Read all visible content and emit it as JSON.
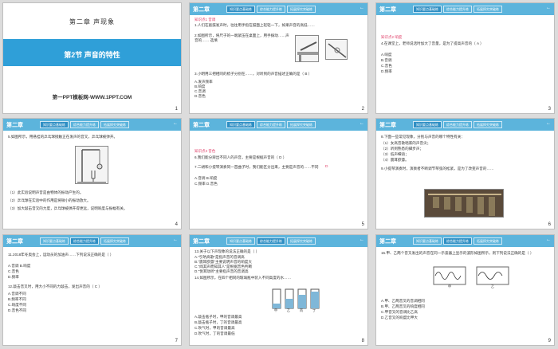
{
  "common": {
    "chapter": "第二章",
    "tabs": [
      "知识要点基础练",
      "综合能力提升练",
      "拓展探究突破练"
    ],
    "back": "←"
  },
  "slides": [
    {
      "num": "1",
      "chapter_title": "第二章  声现象",
      "section_title": "第2节  声音的特性",
      "subtitle": "第一PPT模板网-WWW.1PPT.COM"
    },
    {
      "num": "2",
      "tag": "知识点1  音调",
      "q1": "1.人们在敲鼓发声时，往往用手指在鼓面上轻轻一下，如果声音的高低……",
      "q2": "2.如图所示，将尺子的一端紧压在桌面上，用手拨动……声音的…… 选填",
      "q3": "3.小明用三把相同的梳子分别在……，对听到的声音描述正确的是（ B ）",
      "opt_a": "A.发声频率",
      "opt_b": "B.响度",
      "opt_c": "C.音调",
      "opt_d": "D.音色",
      "answer_b": "B"
    },
    {
      "num": "3",
      "tag": "知识点2  响度",
      "q1": "4.在课堂上，老师说话时加大了音量，是为了提高声音的（ A ）",
      "q1_ans": "A",
      "opts": [
        "A.响度",
        "B.音调",
        "C.音色",
        "D.频率"
      ]
    },
    {
      "num": "4",
      "q1": "5.如图所示，用悬挂的乒乓球接触正在发声的音叉，乒乓球被弹开。",
      "q2": "（1）此实验说明声音是由物体的振动产生的。",
      "q3": "（2）乒乓球在实验中的作用是将微小的振动放大。",
      "q4": "（3）加大敲击音叉的力度，乒乓球被弹开得更远，说明响度与振幅有关。"
    },
    {
      "num": "5",
      "tag": "知识点3  音色",
      "q1": "6.我们能分辨出不同人的声音，主要是根据声音的（ D ）",
      "q2": "7.二胡和小提琴演奏同一首曲子时，我们能区分出来，主要是声音的……不同",
      "opts": [
        "A.音调  B.响度",
        "C.频率  D.音色"
      ],
      "ans": "D"
    },
    {
      "num": "6",
      "q1": "8.下面一些常见现象，分别与声音的哪个特性有关：",
      "lines": [
        "（1）女高音歌唱家的声音尖；",
        "（2）听到熟悉的脚步声；",
        "（3）低声细语；",
        "（4）震耳欲聋。"
      ],
      "q2": "9.小提琴演奏时，演奏者不断调节琴弦的松紧，是为了改变声音的……"
    },
    {
      "num": "7",
      "q1": "11.2018年冬奥会上，运动员的加油声……下列说法正确的是（  ）",
      "opts": [
        "A.音调  B.响度",
        "C.音色",
        "D.频率"
      ],
      "q2": "12.敲击音叉时，用大小不同的力敲击，发出声音的（ C ）",
      "opts2": [
        "A.音调不同",
        "B.频率不同",
        "C.响度不同",
        "D.音色不同"
      ],
      "ans": "C"
    },
    {
      "num": "8",
      "q1": "13.关于以下声现象的说法正确的是（  ）",
      "lines": [
        "A.\"引吭高歌\"是指声音的音调高",
        "B.\"震耳欲聋\"主要说明声音的响度大",
        "C.\"闻其声而知其人\"是根据音色判断",
        "D.\"悦耳动听\"主要指声音的音调高"
      ],
      "q2": "14.如图所示，在四个相同的玻璃瓶中装入不同高度的水……",
      "labels": [
        "甲",
        "乙",
        "丙",
        "丁"
      ],
      "opts": [
        "A.敲击瓶子时，甲的音调最高",
        "B.敲击瓶子时，丁的音调最高",
        "C.吹气时，甲的音调最高",
        "D.吹气时，丁的音调最低"
      ]
    },
    {
      "num": "9",
      "q1": "15.甲、乙两个音叉发出的声音在同一示波器上显示的波形如图所示，则下列说法正确的是（  ）",
      "labels": [
        "甲",
        "乙"
      ],
      "opts": [
        "A.甲、乙两音叉的音调相同",
        "B.甲、乙两音叉的响度相同",
        "C.甲音叉的音调比乙高",
        "D.乙音叉的响度比甲大"
      ]
    }
  ]
}
